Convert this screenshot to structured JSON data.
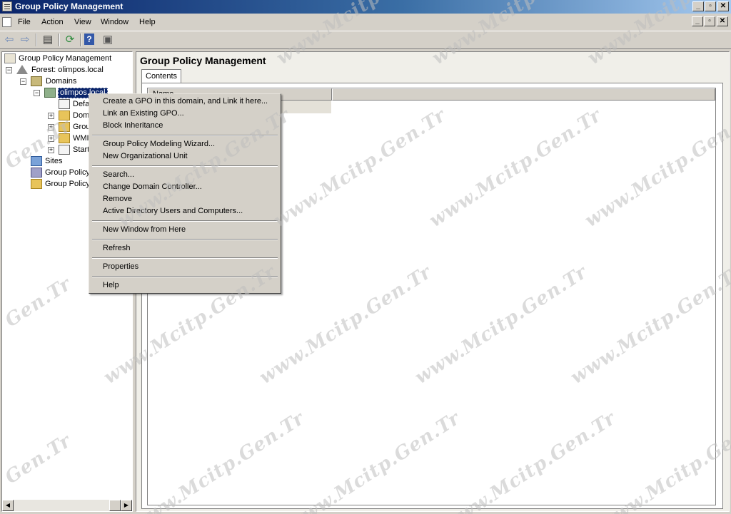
{
  "window": {
    "title": "Group Policy Management",
    "caption_buttons": [
      "_",
      "▫",
      "✕"
    ]
  },
  "menubar": {
    "items": [
      "File",
      "Action",
      "View",
      "Window",
      "Help"
    ]
  },
  "tree": {
    "root": "Group Policy Management",
    "forest": "Forest: olimpos.local",
    "domains": "Domains",
    "domain": "olimpos.local",
    "children": [
      "Defa",
      "Doma",
      "Grou",
      "WMI",
      "Start"
    ],
    "sites": "Sites",
    "modeling": "Group Policy",
    "results": "Group Policy"
  },
  "content": {
    "title": "Group Policy Management",
    "tab": "Contents",
    "column_name": "Name"
  },
  "context_menu": {
    "items": [
      "Create a GPO in this domain, and Link it here...",
      "Link an Existing GPO...",
      "Block Inheritance",
      "Group Policy Modeling Wizard...",
      "New Organizational Unit",
      "Search...",
      "Change Domain Controller...",
      "Remove",
      "Active Directory Users and Computers...",
      "New Window from Here",
      "Refresh",
      "Properties",
      "Help"
    ]
  },
  "watermark": {
    "site": "www.Mcitp.Gen.Tr",
    "short": "Gen.Tr"
  },
  "colors": {
    "title_bar": "#0a246a",
    "face": "#d4d0c8",
    "selection": "#0a246a"
  }
}
